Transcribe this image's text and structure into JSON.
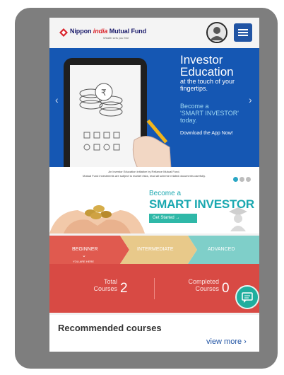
{
  "header": {
    "logo_left": "Nippon ",
    "logo_mid": "india",
    "logo_right": " Mutual Fund",
    "logo_tagline": "Wealth sets you free"
  },
  "hero": {
    "title_line1": "Investor",
    "title_line2": "Education",
    "sub_line1": "at the touch of your",
    "sub_line2": "fingertips.",
    "cta_line1": "Become a",
    "cta_line2": "'SMART INVESTOR'",
    "cta_line3": "today.",
    "download_text": "Download the App Now!",
    "note_line1": "An Investor Education initiative by Reliance Mutual Fund.",
    "note_line2": "Mutual Fund investments are subject to market risks, read all scheme related documents carefully.",
    "prev_glyph": "‹",
    "next_glyph": "›"
  },
  "smart_banner": {
    "line1": "Become a",
    "line2": "SMART INVESTOR",
    "button_label": "Get Started  →"
  },
  "levels": {
    "items": [
      "BEGINNER",
      "INTERMEDIATE",
      "ADVANCED"
    ],
    "current_marker": "YOU ARE HERE",
    "colors": [
      "#e05a4f",
      "#e8c98a",
      "#7fcfc9"
    ]
  },
  "stats": {
    "total_line1": "Total",
    "total_line2": "Courses",
    "total_value": "2",
    "completed_line1": "Completed",
    "completed_line2": "Courses",
    "completed_value": "0"
  },
  "recommended": {
    "title": "Recommended courses",
    "view_more": "view more  ›"
  }
}
